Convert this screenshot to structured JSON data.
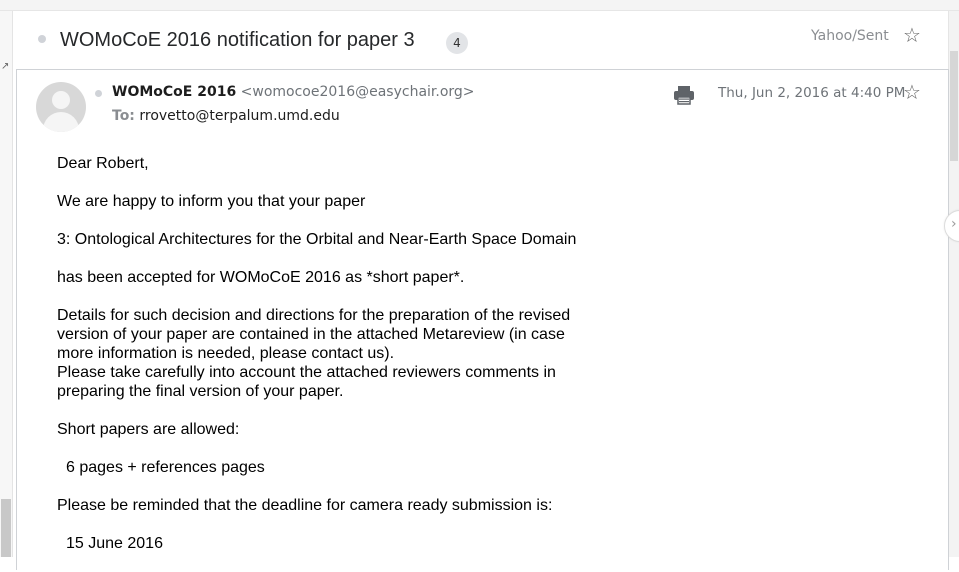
{
  "subject": {
    "title": "WOMoCoE 2016 notification for paper 3",
    "thread_count": "4",
    "folder": "Yahoo/Sent"
  },
  "message": {
    "sender_name": "WOMoCoE 2016",
    "sender_email": "<womocoe2016@easychair.org>",
    "to_label": "To:",
    "to_address": "rrovetto@terpalum.umd.edu",
    "date": "Thu, Jun 2, 2016 at 4:40 PM"
  },
  "body": {
    "greeting": "Dear Robert,",
    "p1": "We are happy to inform you that your paper",
    "paper": "3: Ontological Architectures for the Orbital and Near-Earth Space Domain",
    "p2": "has been accepted for WOMoCoE 2016 as *short paper*.",
    "p3_lines": [
      "Details for such decision and directions for the preparation of the revised",
      "version of your  paper are contained in the attached Metareview (in case",
      "more information is needed, please contact us).",
      "Please take carefully into account the attached reviewers comments in",
      "preparing the final version of your paper."
    ],
    "p4": "Short papers are allowed:",
    "p5": "6 pages + references pages",
    "p6": "Please be reminded that the deadline for camera ready submission is:",
    "p7": "15 June 2016"
  },
  "icons": {
    "star": "star-outline-icon",
    "print": "printer-icon",
    "avatar": "default-avatar-icon"
  },
  "colors": {
    "meta_text": "#6e7378",
    "badge_bg": "#e2e4e7",
    "border": "#cfd2d6"
  }
}
